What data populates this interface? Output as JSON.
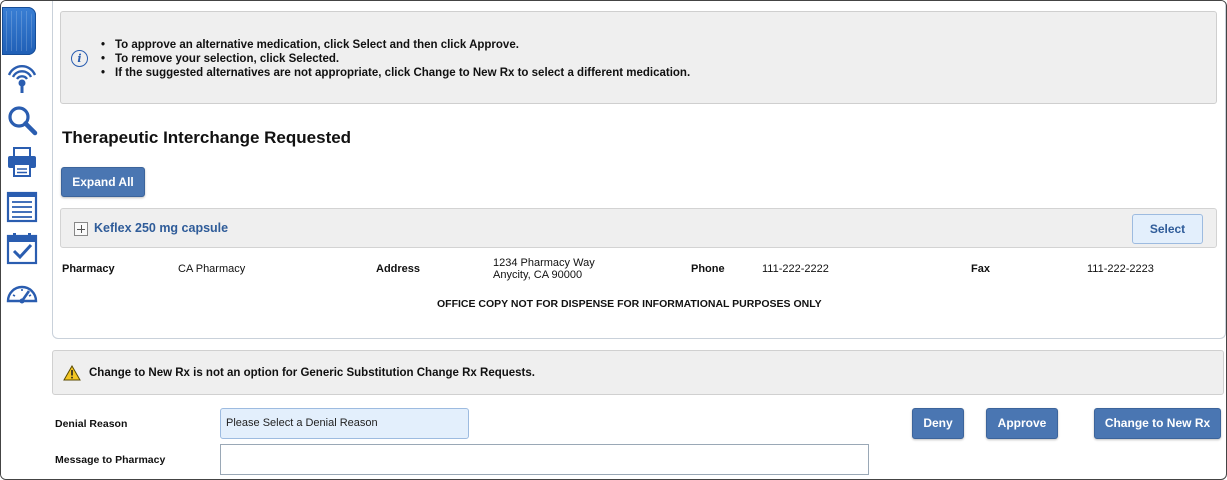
{
  "rail": {
    "icons": [
      "active-module-icon",
      "broadcast-icon",
      "search-icon",
      "printer-icon",
      "report-icon",
      "calendar-check-icon",
      "dashboard-gauge-icon"
    ]
  },
  "info": {
    "icon": "info-icon",
    "items": [
      "To approve an alternative medication, click Select and then click Approve.",
      "To remove your selection, click Selected.",
      "If the suggested alternatives are not appropriate, click Change to New Rx to select a different medication."
    ]
  },
  "section_title": "Therapeutic Interchange Requested",
  "expand_all_label": "Expand All",
  "rx": {
    "name": "Keflex 250 mg capsule",
    "select_label": "Select"
  },
  "pharmacy": {
    "pharmacy_label": "Pharmacy",
    "pharmacy_name": "CA Pharmacy",
    "address_label": "Address",
    "address_line1": "1234 Pharmacy Way",
    "address_line2": "Anycity, CA 90000",
    "phone_label": "Phone",
    "phone": "111-222-2222",
    "fax_label": "Fax",
    "fax": "111-222-2223"
  },
  "office_copy_note": "OFFICE COPY NOT FOR DISPENSE FOR INFORMATIONAL PURPOSES ONLY",
  "warning": {
    "icon": "warning-icon",
    "text": "Change to New Rx is not an option for Generic Substitution Change Rx Requests."
  },
  "form": {
    "denial_reason_label": "Denial Reason",
    "denial_reason_value": "Please Select a Denial Reason",
    "message_label": "Message to Pharmacy",
    "message_value": ""
  },
  "actions": {
    "deny_label": "Deny",
    "approve_label": "Approve",
    "change_label": "Change to New Rx"
  },
  "colors": {
    "primary_button": "#4a76b2",
    "link_blue": "#2f5c99",
    "panel_gray": "#efefef"
  }
}
